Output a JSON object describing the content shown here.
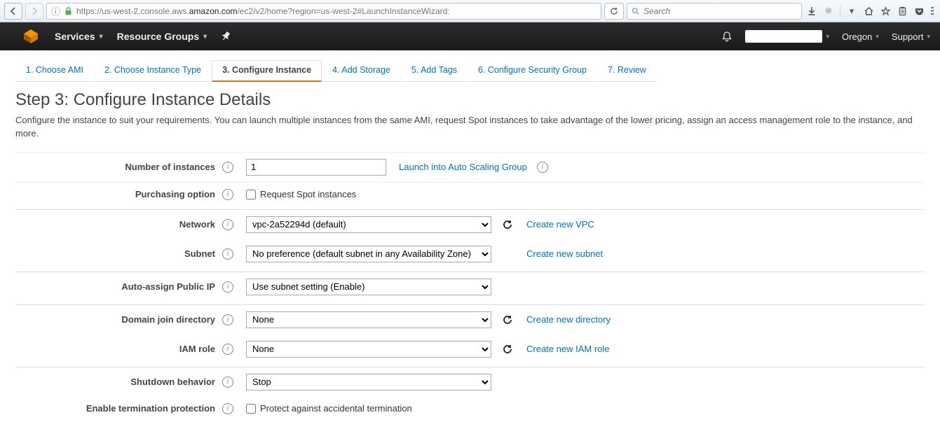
{
  "browser": {
    "url_prefix": "https://us-west-2.console.aws.",
    "url_bold": "amazon.com",
    "url_suffix": "/ec2/v2/home?region=us-west-2#LaunchInstanceWizard:",
    "search_placeholder": "Search"
  },
  "header": {
    "services": "Services",
    "resource_groups": "Resource Groups",
    "region": "Oregon",
    "support": "Support"
  },
  "wizard": {
    "tabs": [
      "1. Choose AMI",
      "2. Choose Instance Type",
      "3. Configure Instance",
      "4. Add Storage",
      "5. Add Tags",
      "6. Configure Security Group",
      "7. Review"
    ],
    "active_index": 2
  },
  "page": {
    "title": "Step 3: Configure Instance Details",
    "desc": "Configure the instance to suit your requirements. You can launch multiple instances from the same AMI, request Spot instances to take advantage of the lower pricing, assign an access management role to the instance, and more."
  },
  "form": {
    "num_instances": {
      "label": "Number of instances",
      "value": "1",
      "link": "Launch into Auto Scaling Group"
    },
    "purchasing": {
      "label": "Purchasing option",
      "checkbox": "Request Spot instances"
    },
    "network": {
      "label": "Network",
      "value": "vpc-2a52294d (default)",
      "link": "Create new VPC"
    },
    "subnet": {
      "label": "Subnet",
      "value": "No preference (default subnet in any Availability Zone)",
      "link": "Create new subnet"
    },
    "public_ip": {
      "label": "Auto-assign Public IP",
      "value": "Use subnet setting (Enable)"
    },
    "domain_dir": {
      "label": "Domain join directory",
      "value": "None",
      "link": "Create new directory"
    },
    "iam": {
      "label": "IAM role",
      "value": "None",
      "link": "Create new IAM role"
    },
    "shutdown": {
      "label": "Shutdown behavior",
      "value": "Stop"
    },
    "term_protect": {
      "label": "Enable termination protection",
      "checkbox": "Protect against accidental termination"
    }
  }
}
